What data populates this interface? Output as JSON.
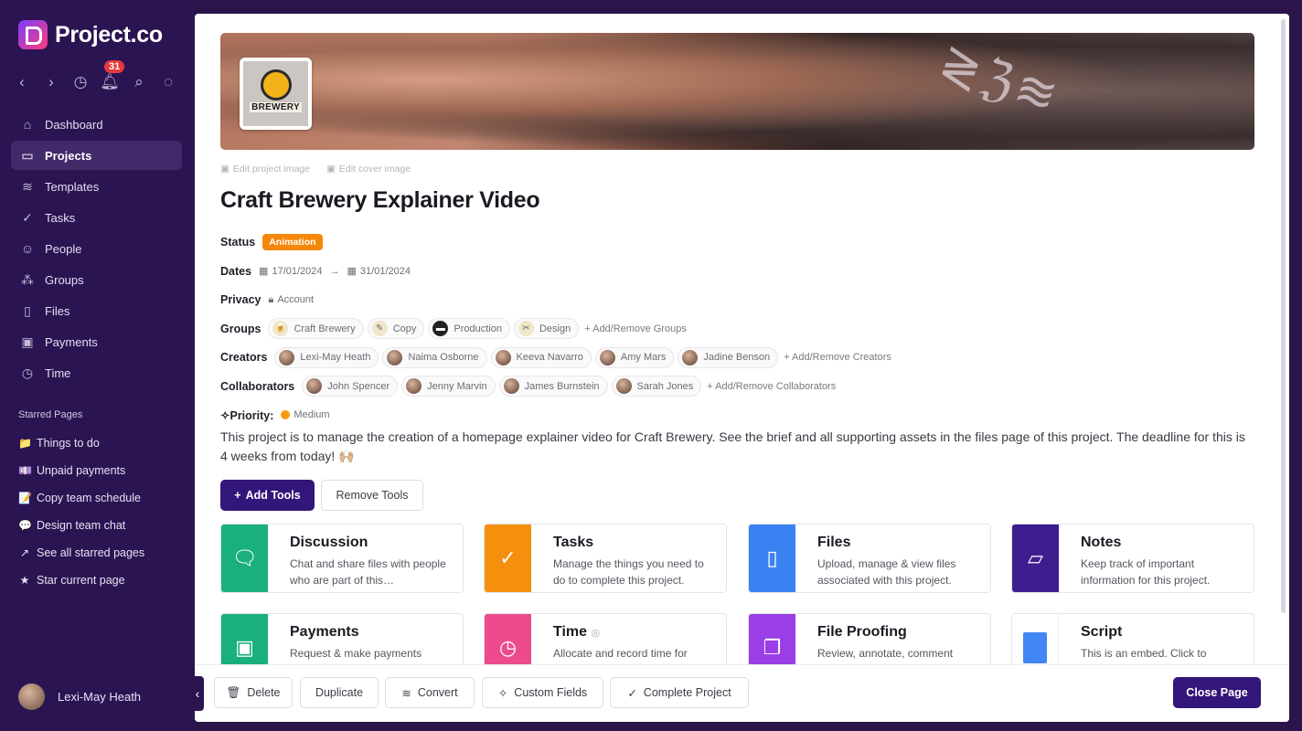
{
  "app": {
    "name": "Project.co"
  },
  "notifications": {
    "count": "31"
  },
  "nav": {
    "items": [
      {
        "label": "Dashboard",
        "icon": "home-icon"
      },
      {
        "label": "Projects",
        "icon": "inbox-icon",
        "active": true
      },
      {
        "label": "Templates",
        "icon": "layers-icon"
      },
      {
        "label": "Tasks",
        "icon": "check-circle-icon"
      },
      {
        "label": "People",
        "icon": "people-icon"
      },
      {
        "label": "Groups",
        "icon": "groups-icon"
      },
      {
        "label": "Files",
        "icon": "file-icon"
      },
      {
        "label": "Payments",
        "icon": "payment-icon"
      },
      {
        "label": "Time",
        "icon": "stopwatch-icon"
      }
    ]
  },
  "starred": {
    "title": "Starred Pages",
    "items": [
      {
        "label": "Things to do",
        "icon": "📁"
      },
      {
        "label": "Unpaid payments",
        "icon": "💷"
      },
      {
        "label": "Copy team schedule",
        "icon": "📝"
      },
      {
        "label": "Design team chat",
        "icon": "💬"
      },
      {
        "label": "See all starred pages",
        "icon": "↗"
      },
      {
        "label": "Star current page",
        "icon": "★"
      }
    ]
  },
  "user": {
    "name": "Lexi-May Heath"
  },
  "project": {
    "image_text": "BREWERY",
    "edit_project_image": "Edit project image",
    "edit_cover_image": "Edit cover image",
    "title": "Craft Brewery Explainer Video",
    "status_label": "Status",
    "status": "Animation",
    "dates_label": "Dates",
    "start_date": "17/01/2024",
    "end_date": "31/01/2024",
    "privacy_label": "Privacy",
    "privacy": "Account",
    "groups_label": "Groups",
    "groups": [
      "Craft Brewery",
      "Copy",
      "Production",
      "Design"
    ],
    "groups_add": "+ Add/Remove Groups",
    "creators_label": "Creators",
    "creators": [
      "Lexi-May Heath",
      "Naima Osborne",
      "Keeva Navarro",
      "Amy Mars",
      "Jadine Benson"
    ],
    "creators_add": "+ Add/Remove Creators",
    "collaborators_label": "Collaborators",
    "collaborators": [
      "John Spencer",
      "Jenny Marvin",
      "James Burnstein",
      "Sarah Jones"
    ],
    "collaborators_add": "+ Add/Remove Collaborators",
    "priority_label": "Priority:",
    "priority": "Medium",
    "description": "This project is to manage the creation of a homepage explainer video for Craft Brewery. See the brief and all supporting assets in the files page of this project. The deadline for this is 4 weeks from today! 🙌🏼"
  },
  "actions": {
    "add_tools": "Add Tools",
    "remove_tools": "Remove Tools"
  },
  "tools": [
    {
      "name": "Discussion",
      "desc": "Chat and share files with people who are part of this…",
      "color": "#19b07d",
      "icon": "chat-icon"
    },
    {
      "name": "Tasks",
      "desc": "Manage the things you need to do to complete this project.",
      "color": "#f5900f",
      "icon": "badge-check-icon"
    },
    {
      "name": "Files",
      "desc": "Upload, manage & view files associated with this project.",
      "color": "#3a82f2",
      "icon": "file-icon"
    },
    {
      "name": "Notes",
      "desc": "Keep track of important information for this project.",
      "color": "#3e1d8f",
      "icon": "note-icon"
    },
    {
      "name": "Payments",
      "desc": "Request & make payments",
      "color": "#19b07d",
      "icon": "money-icon"
    },
    {
      "name": "Time",
      "desc": "Allocate and record time for",
      "color": "#ec4b8c",
      "icon": "stopwatch-icon"
    },
    {
      "name": "File Proofing",
      "desc": "Review, annotate, comment",
      "color": "#9a3ee6",
      "icon": "copy-files-icon"
    },
    {
      "name": "Script",
      "desc": "This is an embed. Click to",
      "color": "#ffffff",
      "icon": "google-doc-icon"
    }
  ],
  "bottom": {
    "delete": "Delete",
    "duplicate": "Duplicate",
    "convert": "Convert",
    "custom_fields": "Custom Fields",
    "complete": "Complete Project",
    "close": "Close Page"
  }
}
